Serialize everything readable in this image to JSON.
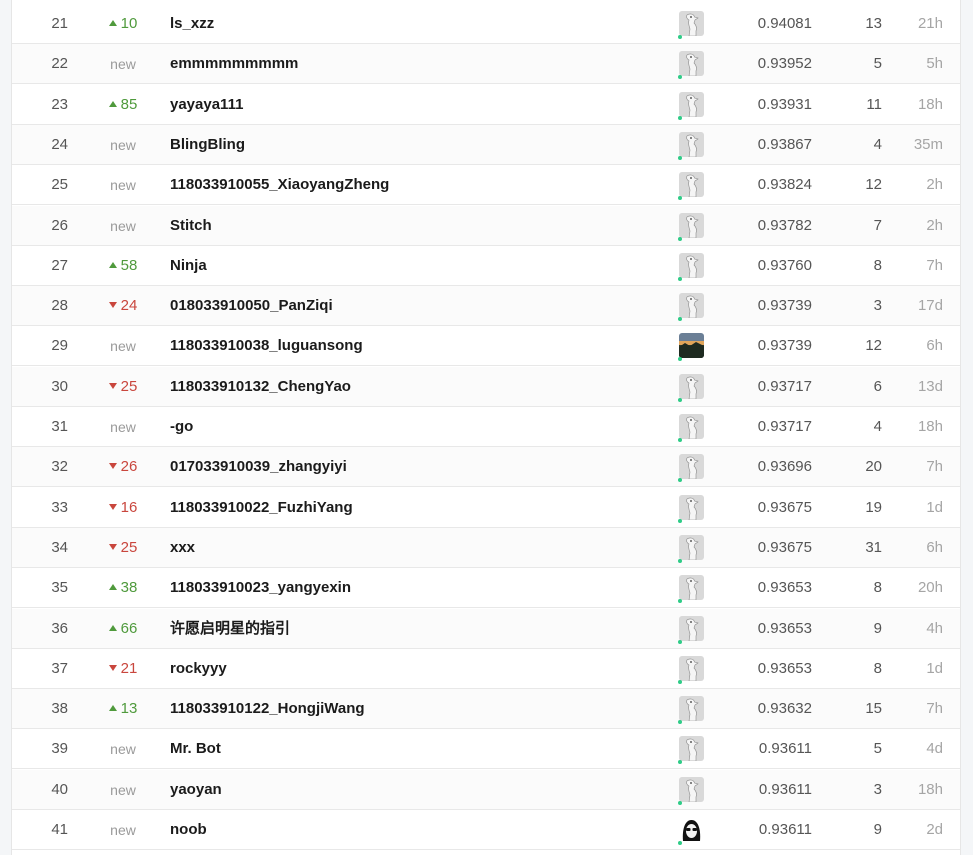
{
  "leaderboard": {
    "rows": [
      {
        "rank": "21",
        "change": {
          "dir": "up",
          "text": "10"
        },
        "team": "ls_xzz",
        "avatar": "goose-avatar-icon",
        "score": "0.94081",
        "entries": "13",
        "last": "21h"
      },
      {
        "rank": "22",
        "change": {
          "dir": "new",
          "text": "new"
        },
        "team": "emmmmmmmmm",
        "avatar": "goose-avatar-icon",
        "score": "0.93952",
        "entries": "5",
        "last": "5h"
      },
      {
        "rank": "23",
        "change": {
          "dir": "up",
          "text": "85"
        },
        "team": "yayaya111",
        "avatar": "goose-avatar-icon",
        "score": "0.93931",
        "entries": "11",
        "last": "18h"
      },
      {
        "rank": "24",
        "change": {
          "dir": "new",
          "text": "new"
        },
        "team": "BlingBling",
        "avatar": "goose-avatar-icon",
        "score": "0.93867",
        "entries": "4",
        "last": "35m"
      },
      {
        "rank": "25",
        "change": {
          "dir": "new",
          "text": "new"
        },
        "team": "118033910055_XiaoyangZheng",
        "avatar": "goose-avatar-icon",
        "score": "0.93824",
        "entries": "12",
        "last": "2h"
      },
      {
        "rank": "26",
        "change": {
          "dir": "new",
          "text": "new"
        },
        "team": "Stitch",
        "avatar": "goose-avatar-icon",
        "score": "0.93782",
        "entries": "7",
        "last": "2h"
      },
      {
        "rank": "27",
        "change": {
          "dir": "up",
          "text": "58"
        },
        "team": "Ninja",
        "avatar": "goose-avatar-icon",
        "score": "0.93760",
        "entries": "8",
        "last": "7h"
      },
      {
        "rank": "28",
        "change": {
          "dir": "down",
          "text": "24"
        },
        "team": "018033910050_PanZiqi",
        "avatar": "goose-avatar-icon",
        "score": "0.93739",
        "entries": "3",
        "last": "17d"
      },
      {
        "rank": "29",
        "change": {
          "dir": "new",
          "text": "new"
        },
        "team": "118033910038_luguansong",
        "avatar": "landscape-photo-avatar-icon",
        "score": "0.93739",
        "entries": "12",
        "last": "6h"
      },
      {
        "rank": "30",
        "change": {
          "dir": "down",
          "text": "25"
        },
        "team": "118033910132_ChengYao",
        "avatar": "goose-avatar-icon",
        "score": "0.93717",
        "entries": "6",
        "last": "13d"
      },
      {
        "rank": "31",
        "change": {
          "dir": "new",
          "text": "new"
        },
        "team": "-go",
        "avatar": "goose-avatar-icon",
        "score": "0.93717",
        "entries": "4",
        "last": "18h"
      },
      {
        "rank": "32",
        "change": {
          "dir": "down",
          "text": "26"
        },
        "team": "017033910039_zhangyiyi",
        "avatar": "goose-avatar-icon",
        "score": "0.93696",
        "entries": "20",
        "last": "7h"
      },
      {
        "rank": "33",
        "change": {
          "dir": "down",
          "text": "16"
        },
        "team": "118033910022_FuzhiYang",
        "avatar": "goose-avatar-icon",
        "score": "0.93675",
        "entries": "19",
        "last": "1d"
      },
      {
        "rank": "34",
        "change": {
          "dir": "down",
          "text": "25"
        },
        "team": "xxx",
        "avatar": "goose-avatar-icon",
        "score": "0.93675",
        "entries": "31",
        "last": "6h"
      },
      {
        "rank": "35",
        "change": {
          "dir": "up",
          "text": "38"
        },
        "team": "118033910023_yangyexin",
        "avatar": "goose-avatar-icon",
        "score": "0.93653",
        "entries": "8",
        "last": "20h"
      },
      {
        "rank": "36",
        "change": {
          "dir": "up",
          "text": "66"
        },
        "team": "许愿启明星的指引",
        "avatar": "goose-avatar-icon",
        "score": "0.93653",
        "entries": "9",
        "last": "4h"
      },
      {
        "rank": "37",
        "change": {
          "dir": "down",
          "text": "21"
        },
        "team": "rockyyy",
        "avatar": "goose-avatar-icon",
        "score": "0.93653",
        "entries": "8",
        "last": "1d"
      },
      {
        "rank": "38",
        "change": {
          "dir": "up",
          "text": "13"
        },
        "team": "118033910122_HongjiWang",
        "avatar": "goose-avatar-icon",
        "score": "0.93632",
        "entries": "15",
        "last": "7h"
      },
      {
        "rank": "39",
        "change": {
          "dir": "new",
          "text": "new"
        },
        "team": "Mr. Bot",
        "avatar": "goose-avatar-icon",
        "score": "0.93611",
        "entries": "5",
        "last": "4d"
      },
      {
        "rank": "40",
        "change": {
          "dir": "new",
          "text": "new"
        },
        "team": "yaoyan",
        "avatar": "goose-avatar-icon",
        "score": "0.93611",
        "entries": "3",
        "last": "18h"
      },
      {
        "rank": "41",
        "change": {
          "dir": "new",
          "text": "new"
        },
        "team": "noob",
        "avatar": "sunglasses-portrait-avatar-icon",
        "score": "0.93611",
        "entries": "9",
        "last": "2d"
      }
    ]
  },
  "colors": {
    "up": "#4f9a3c",
    "down": "#c9463d",
    "online_dot": "#2ecc87"
  }
}
